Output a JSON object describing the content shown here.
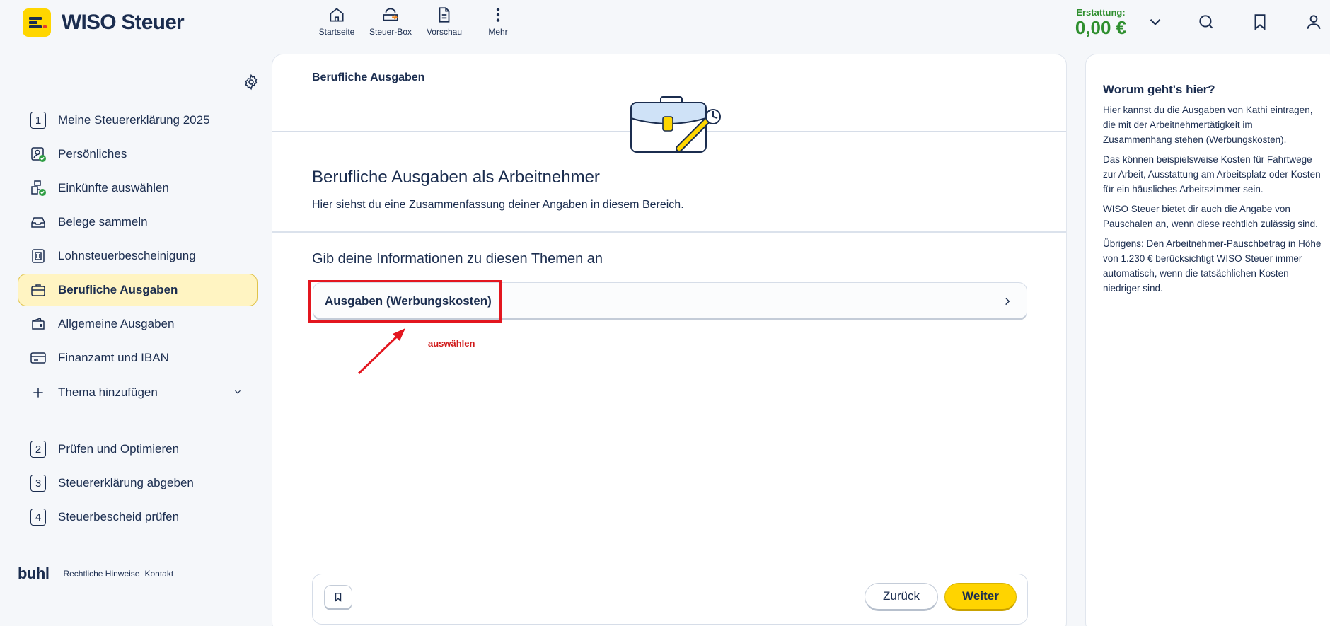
{
  "app": {
    "name": "WISO Steuer"
  },
  "topnav": [
    {
      "label": "Startseite",
      "icon": "home-icon"
    },
    {
      "label": "Steuer-Box",
      "icon": "cloud-upload-icon"
    },
    {
      "label": "Vorschau",
      "icon": "document-icon"
    },
    {
      "label": "Mehr",
      "icon": "more-vertical-icon"
    }
  ],
  "refund": {
    "label": "Erstattung:",
    "value": "0,00 €",
    "color": "#2f8f2f"
  },
  "sidebar": {
    "items": [
      {
        "label": "Meine Steuererklärung 2025",
        "num": "1"
      },
      {
        "label": "Persönliches",
        "icon": "person-check-icon"
      },
      {
        "label": "Einkünfte auswählen",
        "icon": "income-check-icon"
      },
      {
        "label": "Belege sammeln",
        "icon": "inbox-icon"
      },
      {
        "label": "Lohnsteuerbescheinigung",
        "icon": "certificate-icon"
      },
      {
        "label": "Berufliche Ausgaben",
        "icon": "briefcase-icon",
        "active": true
      },
      {
        "label": "Allgemeine Ausgaben",
        "icon": "wallet-icon"
      },
      {
        "label": "Finanzamt und IBAN",
        "icon": "card-icon"
      }
    ],
    "add_topic": "Thema hinzufügen",
    "steps": [
      {
        "num": "2",
        "label": "Prüfen und Optimieren"
      },
      {
        "num": "3",
        "label": "Steuererklärung abgeben"
      },
      {
        "num": "4",
        "label": "Steuerbescheid prüfen"
      }
    ],
    "footer": {
      "brand": "buhl",
      "links": [
        "Rechtliche Hinweise",
        "Kontakt"
      ]
    }
  },
  "main": {
    "breadcrumb": "Berufliche Ausgaben",
    "title": "Berufliche Ausgaben als Arbeitnehmer",
    "subtitle": "Hier siehst du eine Zusammenfassung deiner Angaben in diesem Bereich.",
    "section_title": "Gib deine Informationen zu diesen Themen an",
    "card_label": "Ausgaben (Werbungskosten)",
    "annotation": "auswählen",
    "annotation_color": "#e3161f",
    "back_label": "Zurück",
    "next_label": "Weiter",
    "accent": "#ffd400"
  },
  "help": {
    "title": "Worum geht's hier?",
    "paragraphs": [
      "Hier kannst du die Ausgaben von Kathi eintragen, die mit der Arbeitnehmertätigkeit im Zusammenhang stehen (Werbungskosten).",
      "Das können beispielsweise Kosten für Fahrtwege zur Arbeit, Ausstattung am Arbeitsplatz oder Kosten für ein häusliches Arbeitszimmer sein.",
      "WISO Steuer bietet dir auch die Angabe von Pauschalen an, wenn diese rechtlich zulässig sind.",
      "Übrigens: Den Arbeitnehmer-Pauschbetrag in Höhe von 1.230 € berücksichtigt WISO Steuer immer automatisch, wenn die tatsächlichen Kosten niedriger sind."
    ]
  }
}
